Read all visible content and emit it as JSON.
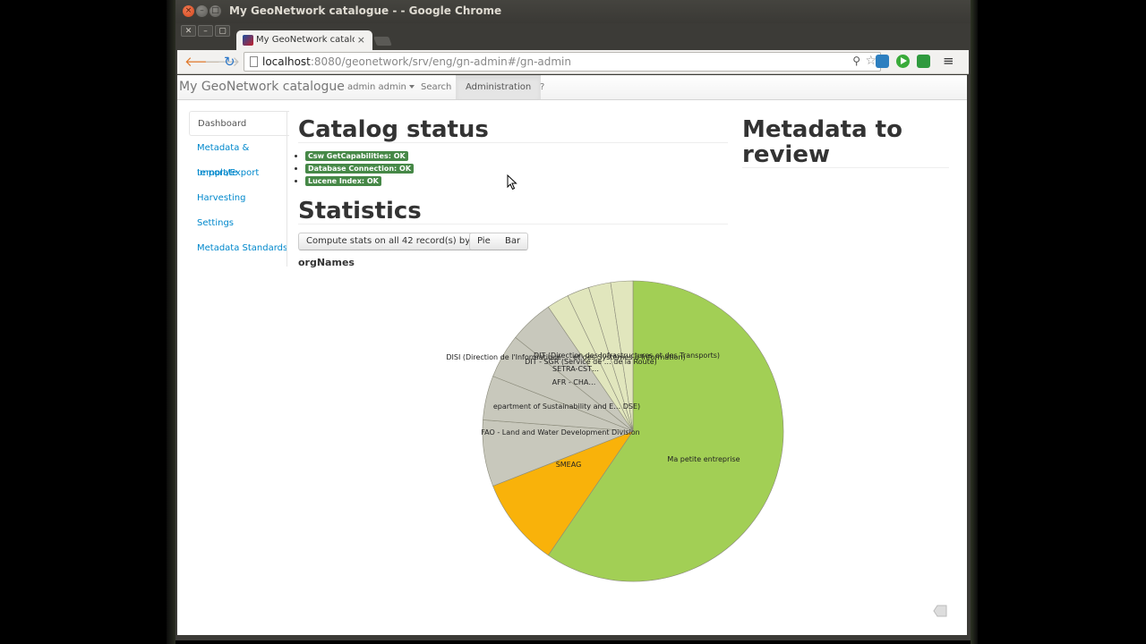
{
  "window": {
    "title": "My GeoNetwork catalogue - - Google Chrome"
  },
  "tab": {
    "label": "My GeoNetwork catalogue",
    "close": "×"
  },
  "address": {
    "host": "localhost",
    "rest": ":8080/geonetwork/srv/eng/gn-admin#/gn-admin"
  },
  "navbar": {
    "brand": "My GeoNetwork catalogue",
    "user": "admin admin",
    "search": "Search",
    "administration": "Administration",
    "help": "?"
  },
  "sidebar": {
    "items": [
      {
        "label": "Dashboard"
      },
      {
        "label": "Metadata & template"
      },
      {
        "label": "Import/Export"
      },
      {
        "label": "Harvesting"
      },
      {
        "label": "Settings"
      },
      {
        "label": "Metadata Standards"
      }
    ]
  },
  "catalog_status": {
    "heading": "Catalog status",
    "items": [
      "Csw GetCapabilities: OK",
      "Database Connection: OK",
      "Lucene Index: OK"
    ]
  },
  "metadata_review": {
    "heading_line1": "Metadata to",
    "heading_line2": "review"
  },
  "statistics": {
    "heading": "Statistics",
    "compute_button": "Compute stats on all 42 record(s) by",
    "pie_button": "Pie",
    "bar_button": "Bar"
  },
  "colors": {
    "accent_link": "#0088cc",
    "status_ok": "#468847",
    "pie_main": "#a2cf55",
    "pie_orange": "#f9b20a",
    "pie_gray": "#c8c8bc",
    "pie_light": "#e1e6bd"
  },
  "chart_data": {
    "type": "pie",
    "title": "orgNames",
    "slices": [
      {
        "label": "Ma petite entreprise",
        "value": 25
      },
      {
        "label": "SMEAG",
        "value": 4
      },
      {
        "label": "FAO - Land and Water Development Division",
        "value": 3
      },
      {
        "label": "epartment of Sustainability and E… DSE)",
        "value": 2
      },
      {
        "label": "AFR - CHA…",
        "value": 2
      },
      {
        "label": "DISI (Direction de l'Informatique … et des Systèmes d'Information)",
        "value": 2
      },
      {
        "label": "SETRA-CST…",
        "value": 1
      },
      {
        "label": "DIT - SGR (Service de … de la Route)",
        "value": 1
      },
      {
        "label": "DIT (Direction des Infrastructures et des Transports)",
        "value": 1
      },
      {
        "label": "",
        "value": 1
      }
    ]
  }
}
